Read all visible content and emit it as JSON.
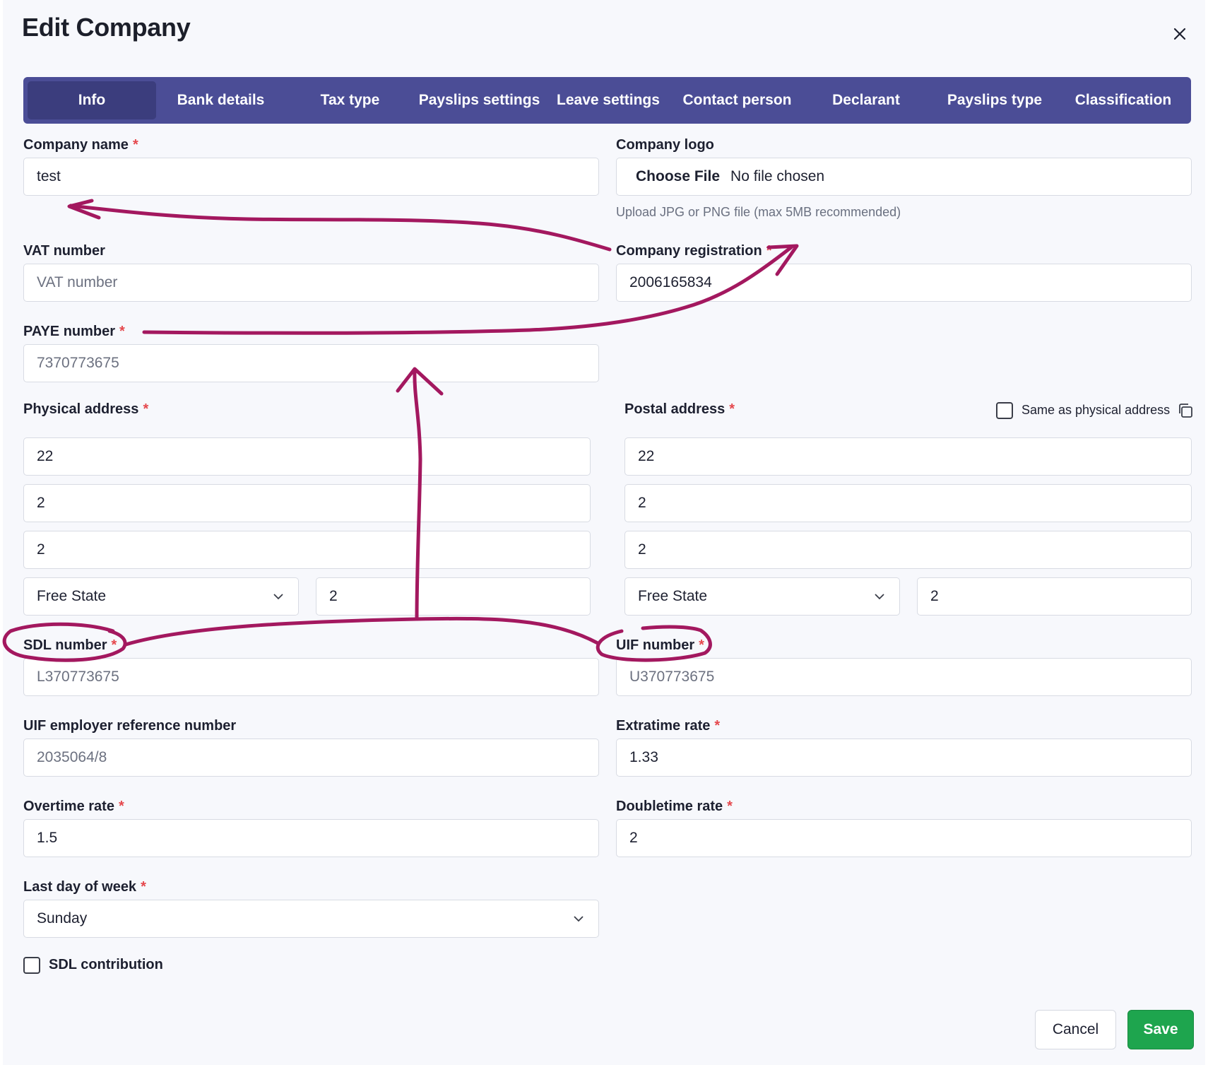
{
  "dialog": {
    "title": "Edit Company"
  },
  "tabs": [
    {
      "label": "Info",
      "active": true
    },
    {
      "label": "Bank details"
    },
    {
      "label": "Tax type"
    },
    {
      "label": "Payslips settings"
    },
    {
      "label": "Leave settings"
    },
    {
      "label": "Contact person"
    },
    {
      "label": "Declarant"
    },
    {
      "label": "Payslips type"
    },
    {
      "label": "Classification"
    }
  ],
  "required_mark": "*",
  "fields": {
    "company_name": {
      "label": "Company name",
      "value": "test"
    },
    "company_logo": {
      "label": "Company logo",
      "button": "Choose File",
      "status": "No file chosen",
      "hint": "Upload JPG or PNG file (max 5MB recommended)"
    },
    "vat_number": {
      "label": "VAT number",
      "placeholder": "VAT number"
    },
    "company_registration": {
      "label": "Company registration",
      "value": "2006165834"
    },
    "paye_number": {
      "label": "PAYE number",
      "value": "7370773675"
    },
    "physical_address": {
      "label": "Physical address",
      "line1": "22",
      "line2": "2",
      "line3": "2",
      "province": "Free State",
      "code": "2"
    },
    "postal_address": {
      "label": "Postal address",
      "same_as_label": "Same as physical address",
      "line1": "22",
      "line2": "2",
      "line3": "2",
      "province": "Free State",
      "code": "2"
    },
    "sdl_number": {
      "label": "SDL number",
      "value": "L370773675"
    },
    "uif_number": {
      "label": "UIF number",
      "value": "U370773675"
    },
    "uif_employer_ref": {
      "label": "UIF employer reference number",
      "value": "2035064/8"
    },
    "extratime_rate": {
      "label": "Extratime rate",
      "value": "1.33"
    },
    "overtime_rate": {
      "label": "Overtime rate",
      "value": "1.5"
    },
    "doubletime_rate": {
      "label": "Doubletime rate",
      "value": "2"
    },
    "last_day_of_week": {
      "label": "Last day of week",
      "value": "Sunday"
    },
    "sdl_contribution": {
      "label": "SDL contribution",
      "checked": false
    }
  },
  "footer": {
    "cancel": "Cancel",
    "save": "Save"
  },
  "colors": {
    "tab_bar": "#4b4d96",
    "tab_active": "#3b3d7d",
    "save": "#1ea54e",
    "required": "#e5484d",
    "annotation": "#a3185f"
  }
}
